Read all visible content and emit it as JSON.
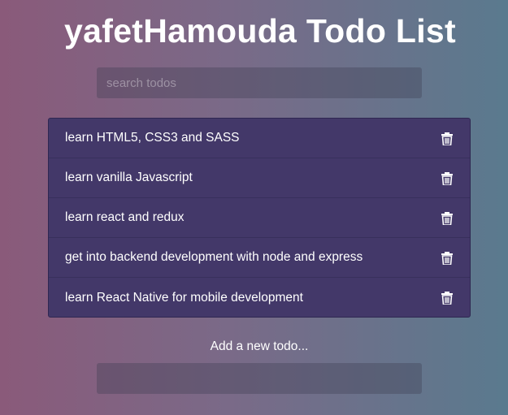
{
  "header": {
    "title": "yafetHamouda Todo List"
  },
  "search": {
    "placeholder": "search todos",
    "value": ""
  },
  "todos": [
    {
      "text": "learn HTML5, CSS3 and SASS",
      "icon": "trash-icon"
    },
    {
      "text": "learn vanilla Javascript",
      "icon": "trash-icon"
    },
    {
      "text": "learn react and redux",
      "icon": "trash-icon"
    },
    {
      "text": "get into backend development with node and express",
      "icon": "trash-icon"
    },
    {
      "text": "learn React Native for mobile development",
      "icon": "trash-icon"
    }
  ],
  "add": {
    "label": "Add a new todo...",
    "value": ""
  },
  "colors": {
    "list_background": "#433869",
    "background_left": "#8a5a7a",
    "background_right": "#5a7a8e",
    "text": "#ffffff"
  }
}
